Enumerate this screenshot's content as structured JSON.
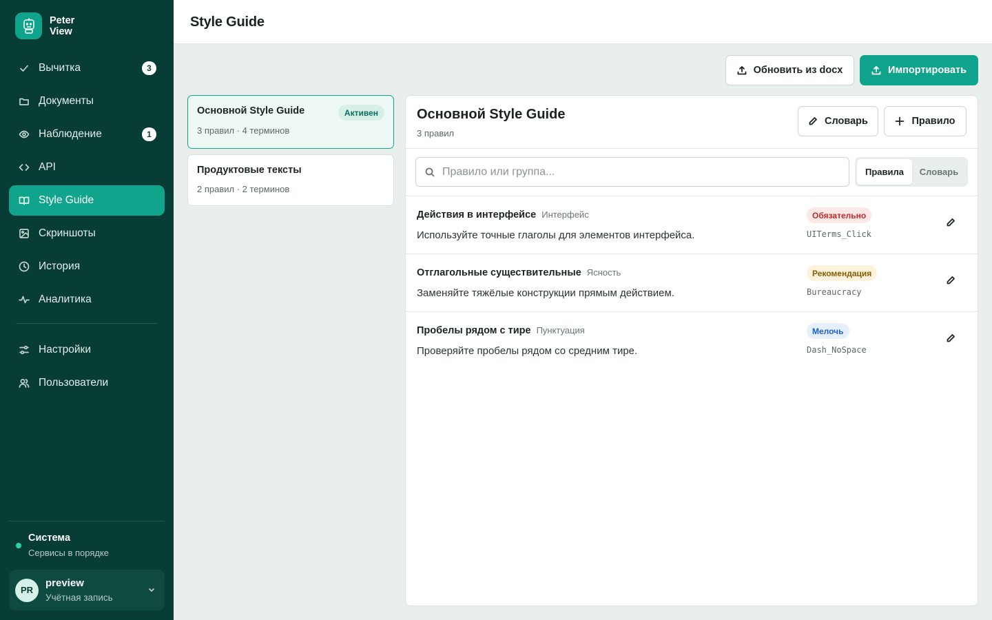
{
  "app": {
    "name": "Peter View",
    "logo_icon": "robot-icon",
    "accent": "#11a48c",
    "sidebar_bg": "#073d35"
  },
  "sidebar": {
    "items": [
      {
        "label": "Вычитка",
        "icon": "check-icon",
        "badge": "3"
      },
      {
        "label": "Документы",
        "icon": "folder-icon"
      },
      {
        "label": "Наблюдение",
        "icon": "eye-icon",
        "badge": "1"
      },
      {
        "label": "API",
        "icon": "code-icon"
      },
      {
        "label": "Style Guide",
        "icon": "book-icon",
        "active": true
      },
      {
        "label": "Скриншоты",
        "icon": "image-icon"
      },
      {
        "label": "История",
        "icon": "clock-icon"
      },
      {
        "label": "Аналитика",
        "icon": "activity-icon"
      }
    ],
    "secondary": [
      {
        "label": "Настройки",
        "icon": "sliders-icon"
      },
      {
        "label": "Пользователи",
        "icon": "users-icon"
      }
    ],
    "system": {
      "title": "Система",
      "status": "Сервисы в порядке",
      "status_color": "#2fd1a9"
    },
    "account": {
      "initials": "PR",
      "name": "preview",
      "subtitle": "Учётная запись"
    }
  },
  "header": {
    "title": "Style Guide"
  },
  "toolbar": {
    "update_label": "Обновить из docx",
    "import_label": "Импортировать"
  },
  "guides": [
    {
      "title": "Основной Style Guide",
      "meta": "3 правил · 4 терминов",
      "badge": "Активен",
      "active": true
    },
    {
      "title": "Продуктовые тексты",
      "meta": "2 правил · 2 терминов"
    }
  ],
  "panel": {
    "title": "Основной Style Guide",
    "subtitle": "3 правил",
    "dictionary_label": "Словарь",
    "add_rule_label": "Правило",
    "search_placeholder": "Правило или группа...",
    "tabs": {
      "rules": "Правила",
      "dictionary": "Словарь",
      "selected": "Правила"
    },
    "rules": [
      {
        "name": "Действия в интерфейсе",
        "group": "Интерфейс",
        "description": "Используйте точные глаголы для элементов интерфейса.",
        "severity": "Обязательно",
        "severity_color": "#c62828",
        "code": "UITerms_Click"
      },
      {
        "name": "Отглагольные существительные",
        "group": "Ясность",
        "description": "Заменяйте тяжёлые конструкции прямым действием.",
        "severity": "Рекомендация",
        "severity_color": "#8a5a00",
        "code": "Bureaucracy"
      },
      {
        "name": "Пробелы рядом с тире",
        "group": "Пунктуация",
        "description": "Проверяйте пробелы рядом со средним тире.",
        "severity": "Мелочь",
        "severity_color": "#1d5fcf",
        "code": "Dash_NoSpace"
      }
    ]
  }
}
